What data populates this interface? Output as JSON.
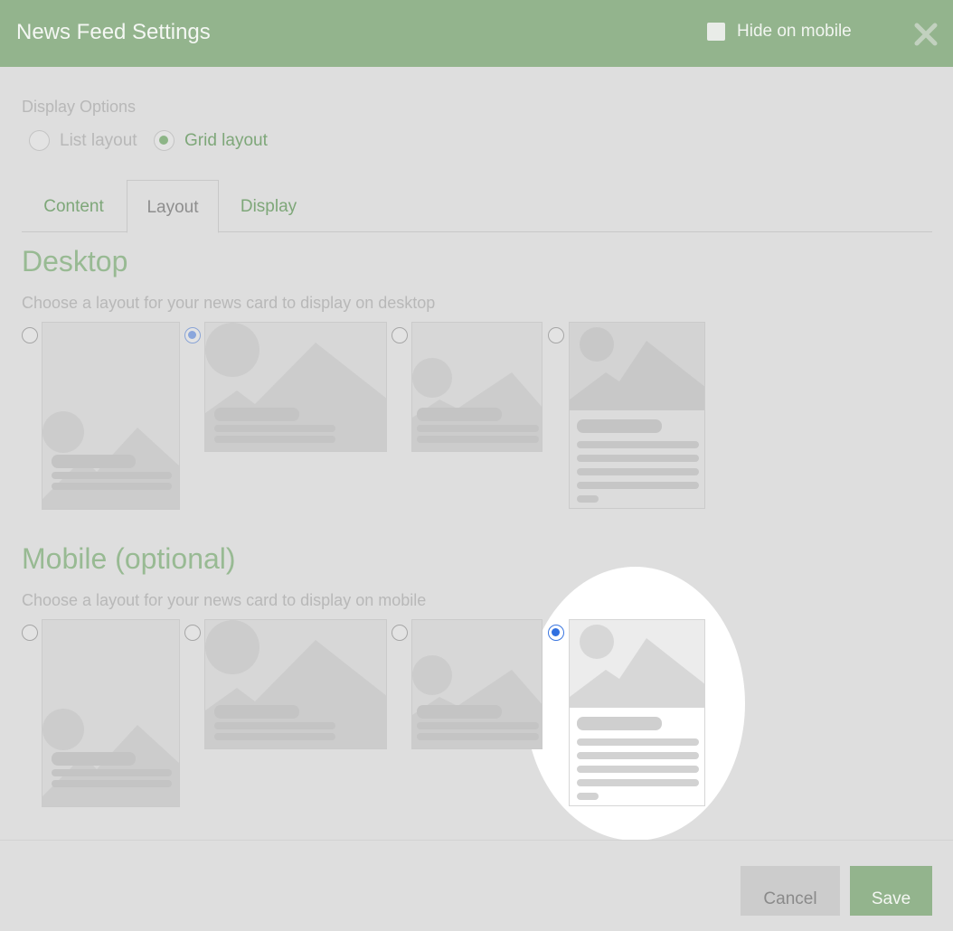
{
  "header": {
    "title": "News Feed Settings",
    "hide_on_mobile_label": "Hide on mobile",
    "hide_on_mobile_checked": false
  },
  "display_options": {
    "label": "Display Options",
    "options": [
      {
        "label": "List layout",
        "selected": false
      },
      {
        "label": "Grid layout",
        "selected": true
      }
    ]
  },
  "tabs": [
    {
      "label": "Content",
      "active": false
    },
    {
      "label": "Layout",
      "active": true
    },
    {
      "label": "Display",
      "active": false
    }
  ],
  "desktop": {
    "heading": "Desktop",
    "description": "Choose a layout for your news card to display on desktop",
    "selected_layout": 2
  },
  "mobile": {
    "heading": "Mobile (optional)",
    "description": "Choose a layout for your news card to display on mobile",
    "selected_layout": 4
  },
  "footer": {
    "cancel_label": "Cancel",
    "save_label": "Save"
  },
  "colors": {
    "header_bg": "#93b48d",
    "accent_green": "#7ea779",
    "heading_green": "#98ba93",
    "radio_blue": "#2f6fe0",
    "overlay_gray": "#dedede",
    "spotlight": "#ffffff"
  },
  "icons": {
    "close": "close-icon",
    "card_image": "image-placeholder-icon"
  }
}
